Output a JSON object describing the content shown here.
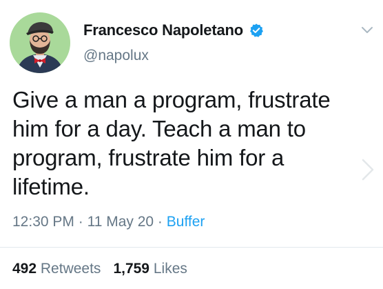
{
  "colors": {
    "accent": "#1da1f2",
    "text_primary": "#14171a",
    "text_secondary": "#657786"
  },
  "author": {
    "display_name": "Francesco Napoletano",
    "handle": "@napolux",
    "verified": true,
    "verified_icon": "verified-badge-icon",
    "avatar_icon": "avatar"
  },
  "tweet": {
    "text": "Give a man a program, frustrate him for a day. Teach a man to program, frustrate him for a lifetime.",
    "time": "12:30 PM",
    "date": "11 May 20",
    "separator": "·",
    "source": "Buffer"
  },
  "stats": {
    "retweets_count": "492",
    "retweets_label": "Retweets",
    "likes_count": "1,759",
    "likes_label": "Likes"
  },
  "controls": {
    "menu_icon": "chevron-down-icon",
    "next_icon": "chevron-right-icon"
  }
}
